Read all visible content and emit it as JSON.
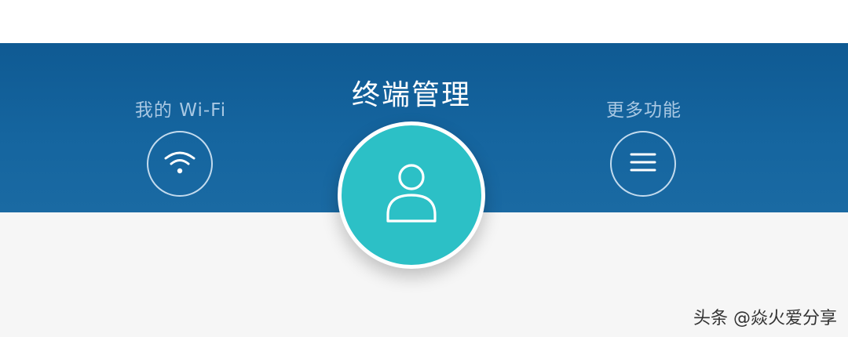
{
  "nav": {
    "wifi_label": "我的 Wi-Fi",
    "title": "终端管理",
    "more_label": "更多功能",
    "icons": {
      "wifi": "wifi-icon",
      "center": "user-icon",
      "more": "menu-icon"
    }
  },
  "watermark": {
    "text": "头条 @焱火爱分享"
  },
  "colors": {
    "banner": "#15629d",
    "accent": "#2cc0c6",
    "label": "#a9c8e3",
    "content_bg": "#f6f6f6"
  }
}
